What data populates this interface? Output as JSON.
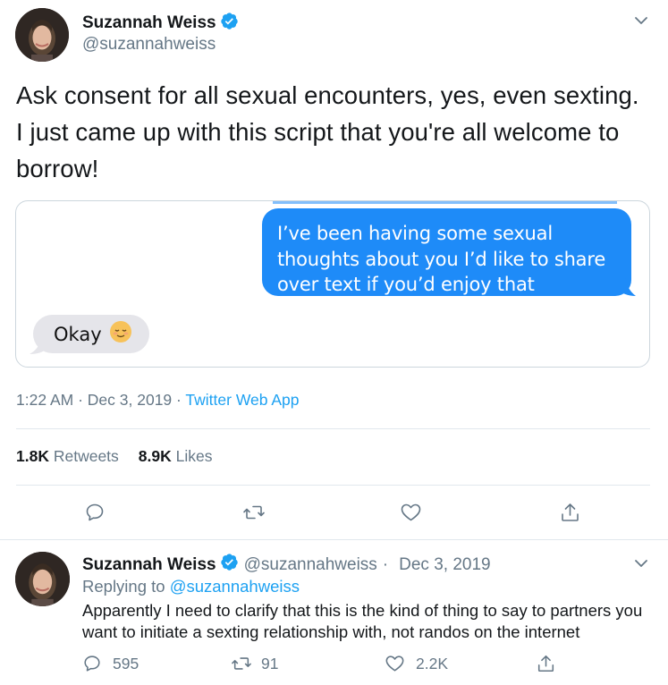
{
  "main_tweet": {
    "author_name": "Suzannah Weiss",
    "author_handle": "@suzannahweiss",
    "text": "Ask consent for all sexual encounters, yes, even sexting. I just came up with this script that you're all welcome to borrow!",
    "media": {
      "outgoing_message": "I’ve been having some sexual thoughts about you I’d like to share over text if you’d enjoy that",
      "incoming_message": "Okay",
      "incoming_emoji": "relieved-face-emoji"
    },
    "time": "1:22 AM",
    "date": "Dec 3, 2019",
    "separator": "·",
    "source_app": "Twitter Web App",
    "retweets_count": "1.8K",
    "retweets_label": "Retweets",
    "likes_count": "8.9K",
    "likes_label": "Likes"
  },
  "reply_tweet": {
    "author_name": "Suzannah Weiss",
    "author_handle": "@suzannahweiss",
    "date": "Dec 3, 2019",
    "separator": "·",
    "replying_label": "Replying to",
    "replying_to": "@suzannahweiss",
    "text": "Apparently I need to clarify that this is the kind of thing to say to partners you want to initiate a sexting relationship with, not randos on the internet",
    "reply_count": "595",
    "retweet_count": "91",
    "like_count": "2.2K"
  },
  "icons": [
    "verified-badge-icon",
    "chevron-down-icon",
    "reply-icon",
    "retweet-icon",
    "like-icon",
    "share-icon"
  ],
  "colors": {
    "accent": "#1da1f2",
    "imessage_blue": "#1e8bf8",
    "muted": "#657786",
    "text": "#14171a",
    "border": "#e1e8ed"
  }
}
